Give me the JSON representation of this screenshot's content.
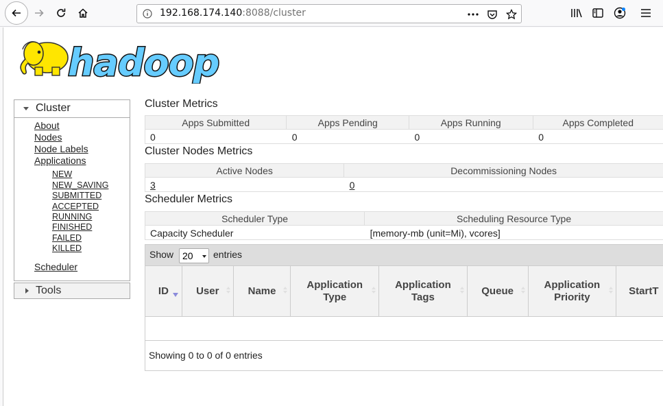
{
  "browser": {
    "url_host": "192.168.174.140",
    "url_rest": ":8088/cluster"
  },
  "logo": {
    "text": "hadoop"
  },
  "sidebar": {
    "cluster_title": "Cluster",
    "links": [
      "About",
      "Nodes",
      "Node Labels",
      "Applications"
    ],
    "app_states": [
      "NEW",
      "NEW_SAVING",
      "SUBMITTED",
      "ACCEPTED",
      "RUNNING",
      "FINISHED",
      "FAILED",
      "KILLED"
    ],
    "scheduler": "Scheduler",
    "tools_title": "Tools"
  },
  "cluster_metrics": {
    "title": "Cluster Metrics",
    "headers": [
      "Apps Submitted",
      "Apps Pending",
      "Apps Running",
      "Apps Completed"
    ],
    "values": [
      "0",
      "0",
      "0",
      "0"
    ]
  },
  "nodes_metrics": {
    "title": "Cluster Nodes Metrics",
    "headers": [
      "Active Nodes",
      "Decommissioning Nodes"
    ],
    "values": [
      "3",
      "0"
    ]
  },
  "scheduler_metrics": {
    "title": "Scheduler Metrics",
    "headers": [
      "Scheduler Type",
      "Scheduling Resource Type"
    ],
    "values": [
      "Capacity Scheduler",
      "[memory-mb (unit=Mi), vcores]"
    ]
  },
  "apps_table": {
    "show_label": "Show",
    "page_length": "20",
    "entries_label": "entries",
    "columns": [
      "ID",
      "User",
      "Name",
      "Application Type",
      "Application Tags",
      "Queue",
      "Application Priority",
      "StartT"
    ],
    "info": "Showing 0 to 0 of 0 entries"
  }
}
